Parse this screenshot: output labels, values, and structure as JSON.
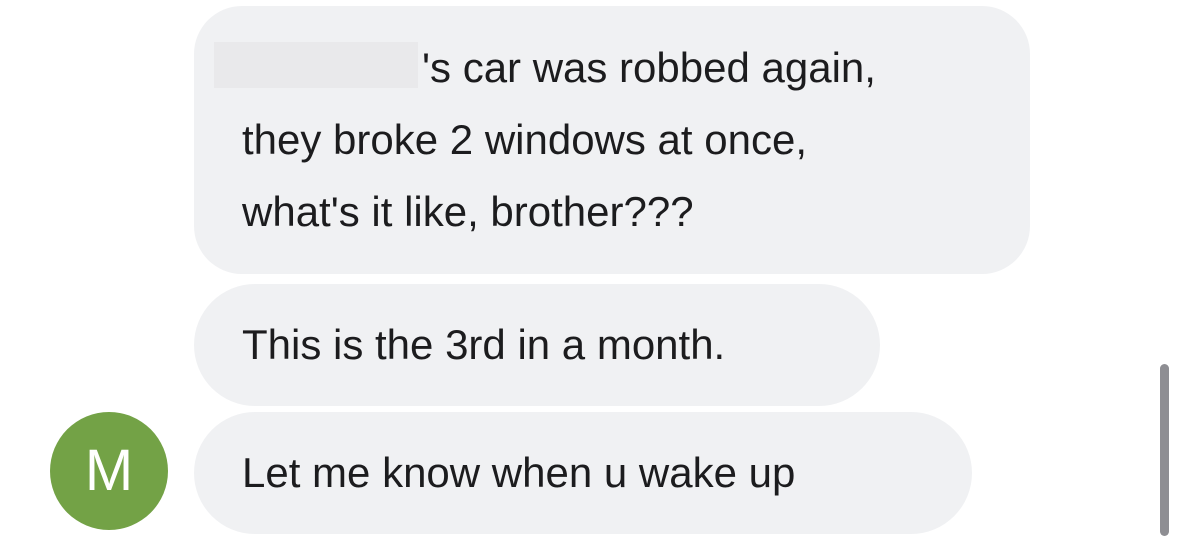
{
  "conversation": {
    "messages": [
      {
        "lines": [
          "'s car was robbed again,",
          "they broke 2 windows at once,",
          "what's it like, brother???"
        ]
      },
      {
        "lines": [
          "This is the 3rd in a month."
        ]
      },
      {
        "lines": [
          "Let me know when u wake up"
        ]
      }
    ],
    "sender": {
      "avatar_initial": "M",
      "avatar_color": "#73a246"
    },
    "bubble_color": "#f0f1f3"
  }
}
